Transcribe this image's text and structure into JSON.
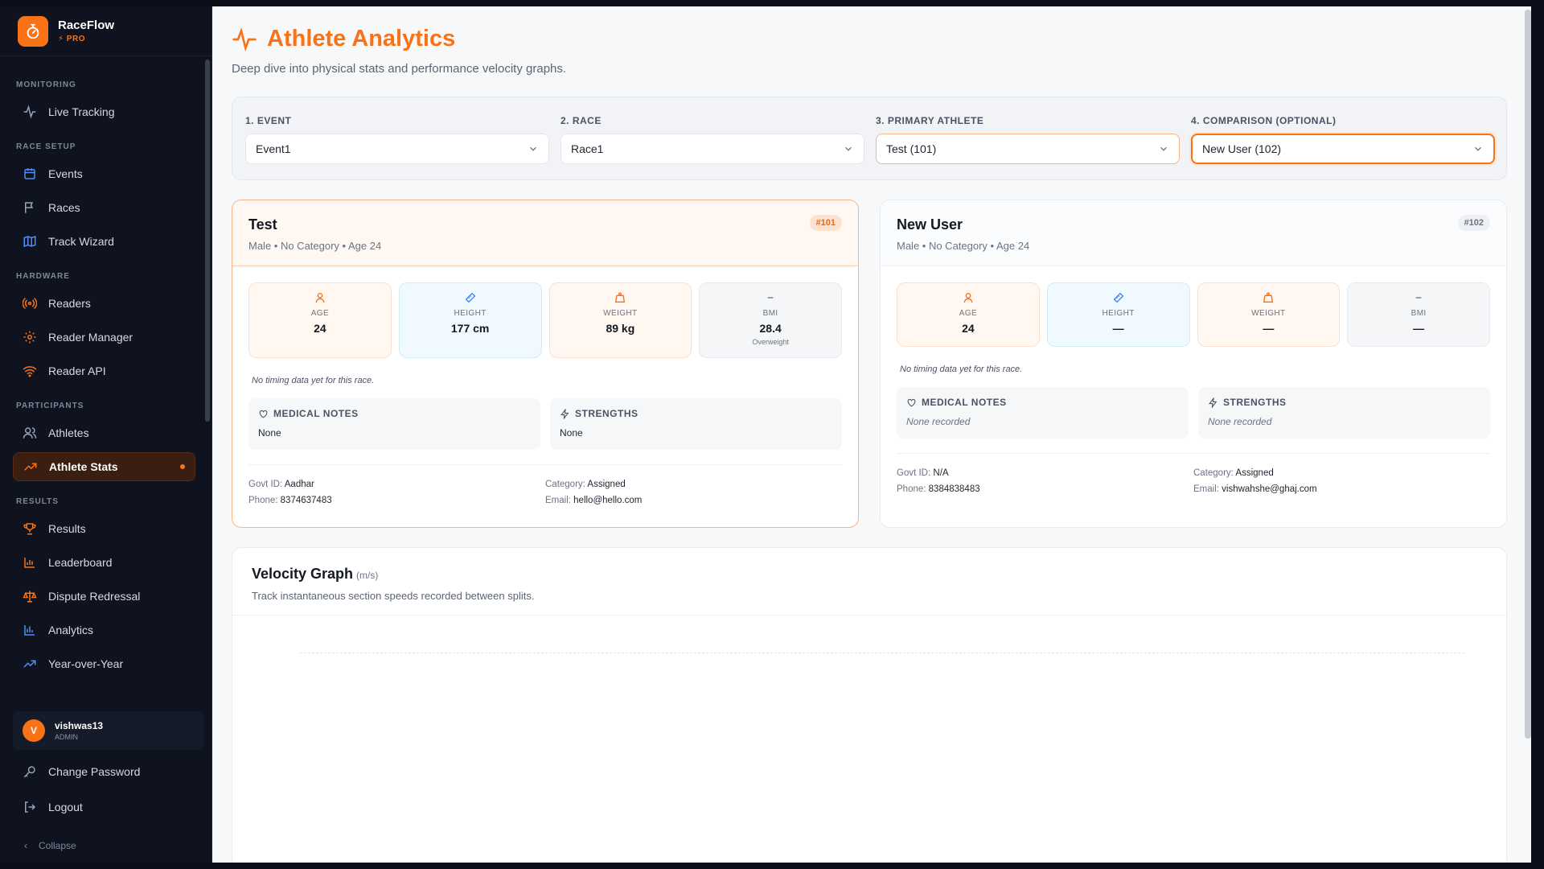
{
  "brand": {
    "name": "RaceFlow",
    "tier": "⚡ PRO"
  },
  "sidebar": {
    "sections": [
      {
        "label": "MONITORING",
        "items": [
          {
            "label": "Live Tracking",
            "icon": "activity-icon"
          }
        ]
      },
      {
        "label": "RACE SETUP",
        "items": [
          {
            "label": "Events",
            "icon": "calendar-icon"
          },
          {
            "label": "Races",
            "icon": "flag-icon"
          },
          {
            "label": "Track Wizard",
            "icon": "map-icon"
          }
        ]
      },
      {
        "label": "HARDWARE",
        "items": [
          {
            "label": "Readers",
            "icon": "radio-icon"
          },
          {
            "label": "Reader Manager",
            "icon": "gear-icon"
          },
          {
            "label": "Reader API",
            "icon": "wifi-icon"
          }
        ]
      },
      {
        "label": "PARTICIPANTS",
        "items": [
          {
            "label": "Athletes",
            "icon": "users-icon"
          },
          {
            "label": "Athlete Stats",
            "icon": "trending-up-icon",
            "active": true
          }
        ]
      },
      {
        "label": "RESULTS",
        "items": [
          {
            "label": "Results",
            "icon": "trophy-icon"
          },
          {
            "label": "Leaderboard",
            "icon": "bar-chart-icon"
          },
          {
            "label": "Dispute Redressal",
            "icon": "scale-icon"
          },
          {
            "label": "Analytics",
            "icon": "analytics-icon"
          },
          {
            "label": "Year-over-Year",
            "icon": "trending-up-icon"
          }
        ]
      }
    ],
    "user": {
      "initial": "V",
      "name": "vishwas13",
      "role": "ADMIN"
    },
    "change_password": "Change Password",
    "logout": "Logout",
    "collapse": "Collapse"
  },
  "header": {
    "title": "Athlete Analytics",
    "subtitle": "Deep dive into physical stats and performance velocity graphs."
  },
  "filters": [
    {
      "label": "1. EVENT",
      "value": "Event1"
    },
    {
      "label": "2. RACE",
      "value": "Race1"
    },
    {
      "label": "3. PRIMARY ATHLETE",
      "value": "Test (101)"
    },
    {
      "label": "4. COMPARISON (OPTIONAL)",
      "value": "New User (102)"
    }
  ],
  "primary": {
    "name": "Test",
    "meta": "Male • No Category • Age 24",
    "bib": "#101",
    "stats": {
      "age_label": "AGE",
      "age": "24",
      "height_label": "HEIGHT",
      "height": "177 cm",
      "weight_label": "WEIGHT",
      "weight": "89 kg",
      "bmi_label": "BMI",
      "bmi": "28.4",
      "bmi_note": "Overweight"
    },
    "note": "No timing data yet for this race.",
    "medical_title": "MEDICAL NOTES",
    "medical": "None",
    "strengths_title": "STRENGTHS",
    "strengths": "None",
    "govt_label": "Govt ID:",
    "govt": "Aadhar",
    "phone_label": "Phone:",
    "phone": "8374637483",
    "category_label": "Category:",
    "category": "Assigned",
    "email_label": "Email:",
    "email": "hello@hello.com"
  },
  "secondary": {
    "name": "New User",
    "meta": "Male • No Category • Age 24",
    "bib": "#102",
    "stats": {
      "age_label": "AGE",
      "age": "24",
      "height_label": "HEIGHT",
      "height": "—",
      "weight_label": "WEIGHT",
      "weight": "—",
      "bmi_label": "BMI",
      "bmi": "—"
    },
    "note": "No timing data yet for this race.",
    "medical_title": "MEDICAL NOTES",
    "medical": "None recorded",
    "strengths_title": "STRENGTHS",
    "strengths": "None recorded",
    "govt_label": "Govt ID:",
    "govt": "N/A",
    "phone_label": "Phone:",
    "phone": "8384838483",
    "category_label": "Category:",
    "category": "Assigned",
    "email_label": "Email:",
    "email": "vishwahshe@ghaj.com"
  },
  "velocity": {
    "title": "Velocity Graph",
    "unit": "(m/s)",
    "subtitle": "Track instantaneous section speeds recorded between splits."
  },
  "colors": {
    "accent": "#f97316",
    "sidebar_bg": "#0f1320",
    "active_bg": "#3b1e12"
  }
}
